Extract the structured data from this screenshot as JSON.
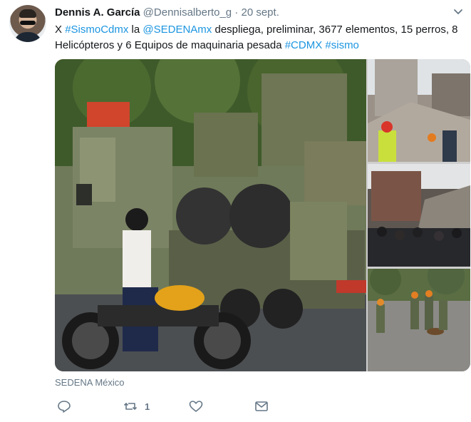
{
  "tweet": {
    "author_name": "Dennis A. García",
    "handle": "@Dennisalberto_g",
    "separator": "·",
    "date": "20 sept.",
    "text_parts": [
      {
        "text": "X ",
        "link": false
      },
      {
        "text": "#SismoCdmx",
        "link": true
      },
      {
        "text": " la ",
        "link": false
      },
      {
        "text": "@SEDENAmx",
        "link": true
      },
      {
        "text": " despliega, preliminar, 3677 elementos, 15 perros, 8 Helicópteros y 6 Equipos de maquinaria pesada ",
        "link": false
      },
      {
        "text": "#CDMX",
        "link": true
      },
      {
        "text": " ",
        "link": false
      },
      {
        "text": "#sismo",
        "link": true
      }
    ],
    "media_source": "SEDENA México"
  },
  "actions": {
    "reply_icon": "reply-icon",
    "retweet_icon": "retweet-icon",
    "retweet_count": "1",
    "like_icon": "heart-icon",
    "dm_icon": "envelope-icon"
  },
  "colors": {
    "link": "#1b95e0",
    "muted": "#657786",
    "text": "#14171a"
  }
}
